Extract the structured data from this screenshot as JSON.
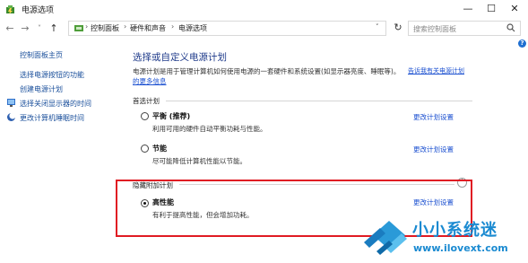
{
  "window": {
    "title": "电源选项",
    "minimize_glyph": "—",
    "maximize_glyph": "☐",
    "close_glyph": "✕"
  },
  "nav": {
    "back_glyph": "←",
    "forward_glyph": "→",
    "recent_glyph": "˅",
    "up_glyph": "↑",
    "refresh_glyph": "↻",
    "dropdown_glyph": "˅",
    "breadcrumbs": [
      "控制面板",
      "硬件和声音",
      "电源选项"
    ],
    "separator": "›"
  },
  "search": {
    "placeholder": "搜索控制面板"
  },
  "help": {
    "glyph": "?"
  },
  "sidebar": {
    "items": [
      {
        "label": "控制面板主页",
        "icon": "none"
      },
      {
        "label": "选择电源按钮的功能",
        "icon": "none"
      },
      {
        "label": "创建电源计划",
        "icon": "none"
      },
      {
        "label": "选择关闭显示器的时间",
        "icon": "monitor-icon"
      },
      {
        "label": "更改计算机睡眠时间",
        "icon": "moon-icon"
      }
    ]
  },
  "main": {
    "heading": "选择或自定义电源计划",
    "description_line1": "电源计划是用于管理计算机如何使用电源的一套硬件和系统设置(如显示器亮度、睡眠等)。",
    "description_link_a": "告诉我有关电源计划",
    "description_link_b": "的更多信息",
    "preferred_group": "首选计划",
    "hidden_group": "隐藏附加计划",
    "expand_glyph": "˄",
    "plans": [
      {
        "name": "平衡 (推荐)",
        "desc": "利用可用的硬件自动平衡功耗与性能。",
        "change": "更改计划设置",
        "selected": false
      },
      {
        "name": "节能",
        "desc": "尽可能降低计算机性能以节能。",
        "change": "更改计划设置",
        "selected": false
      },
      {
        "name": "高性能",
        "desc": "有利于提高性能，但会增加功耗。",
        "change": "更改计划设置",
        "selected": true
      }
    ]
  },
  "watermark": {
    "title": "小小系统迷",
    "url": "www.ilovext.com"
  },
  "colors": {
    "link": "#1a4fd0",
    "heading": "#1e3a8a",
    "highlight": "#e01b23",
    "watermark": "#1a8ad1"
  }
}
